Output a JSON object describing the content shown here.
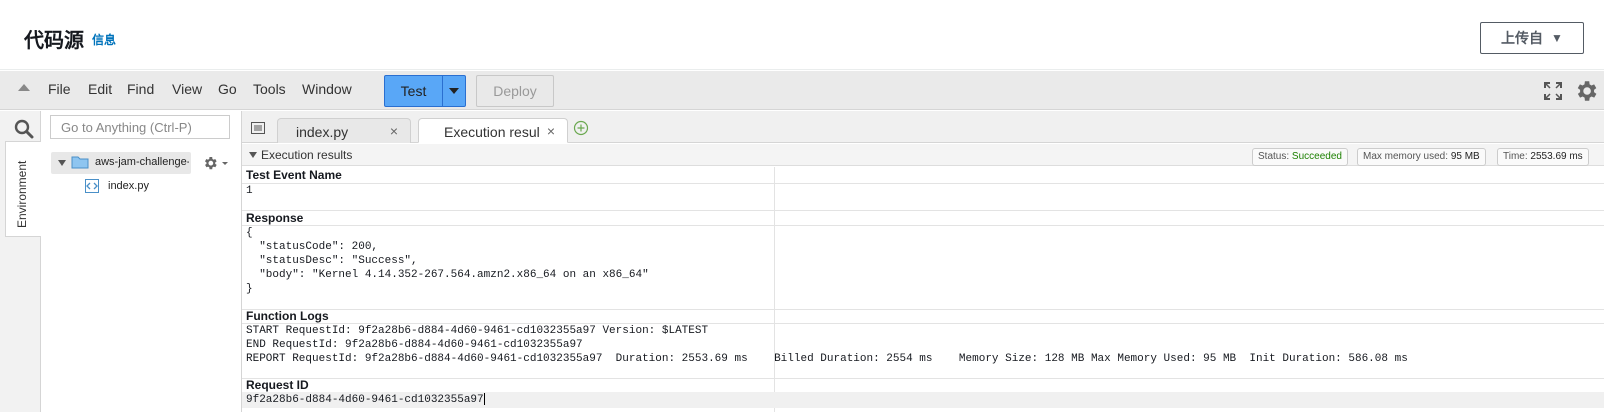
{
  "header": {
    "title": "代码源",
    "info_link": "信息",
    "upload_button": "上传自"
  },
  "menubar": {
    "items": [
      "File",
      "Edit",
      "Find",
      "View",
      "Go",
      "Tools",
      "Window"
    ],
    "test_button": "Test",
    "deploy_button": "Deploy"
  },
  "sidebar": {
    "environment_tab": "Environment",
    "goto_placeholder": "Go to Anything (Ctrl-P)",
    "folder_name": "aws-jam-challenge-",
    "file_name": "index.py"
  },
  "tabs": [
    {
      "label": "index.py",
      "active": false
    },
    {
      "label": "Execution results",
      "active": true
    }
  ],
  "results": {
    "header_label": "Execution results",
    "status_label": "Status:",
    "status_value": "Succeeded",
    "memory_label": "Max memory used:",
    "memory_value": "95 MB",
    "time_label": "Time:",
    "time_value": "2553.69 ms",
    "test_event_heading": "Test Event Name",
    "test_event_value": "1",
    "response_heading": "Response",
    "response_lines": [
      "{",
      "  \"statusCode\": 200,",
      "  \"statusDesc\": \"Success\",",
      "  \"body\": \"Kernel 4.14.352-267.564.amzn2.x86_64 on an x86_64\"",
      "}"
    ],
    "function_logs_heading": "Function Logs",
    "log_lines": [
      "START RequestId: 9f2a28b6-d884-4d60-9461-cd1032355a97 Version: $LATEST",
      "END RequestId: 9f2a28b6-d884-4d60-9461-cd1032355a97",
      "REPORT RequestId: 9f2a28b6-d884-4d60-9461-cd1032355a97  Duration: 2553.69 ms    Billed Duration: 2554 ms    Memory Size: 128 MB Max Memory Used: 95 MB  Init Duration: 586.08 ms"
    ],
    "request_id_heading": "Request ID",
    "request_id_value": "9f2a28b6-d884-4d60-9461-cd1032355a97"
  },
  "colors": {
    "accent_blue": "#0073bb",
    "test_button": "#59a7f7",
    "success_green": "#1d8102"
  }
}
